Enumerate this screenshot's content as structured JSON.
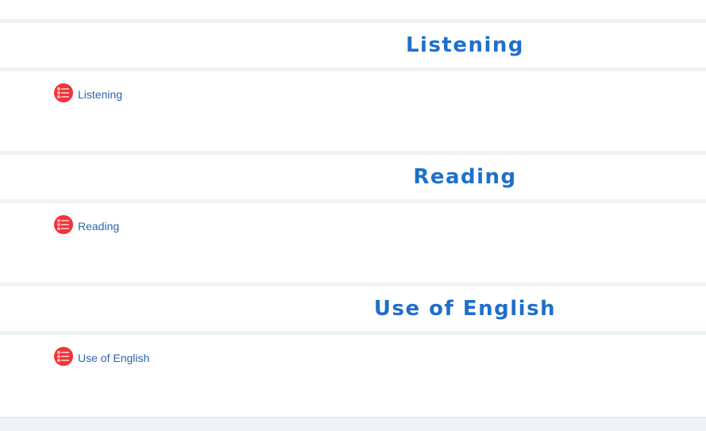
{
  "sections": [
    {
      "title": "Listening",
      "activity_label": "Listening",
      "activity_icon": "checklist-icon"
    },
    {
      "title": "Reading",
      "activity_label": "Reading",
      "activity_icon": "checklist-icon"
    },
    {
      "title": "Use of English",
      "activity_label": "Use of English",
      "activity_icon": "checklist-icon"
    }
  ],
  "colors": {
    "title": "#1f6fcb",
    "link": "#2a64ad",
    "icon_bg": "#f0343a",
    "divider": "#eef3f7"
  }
}
